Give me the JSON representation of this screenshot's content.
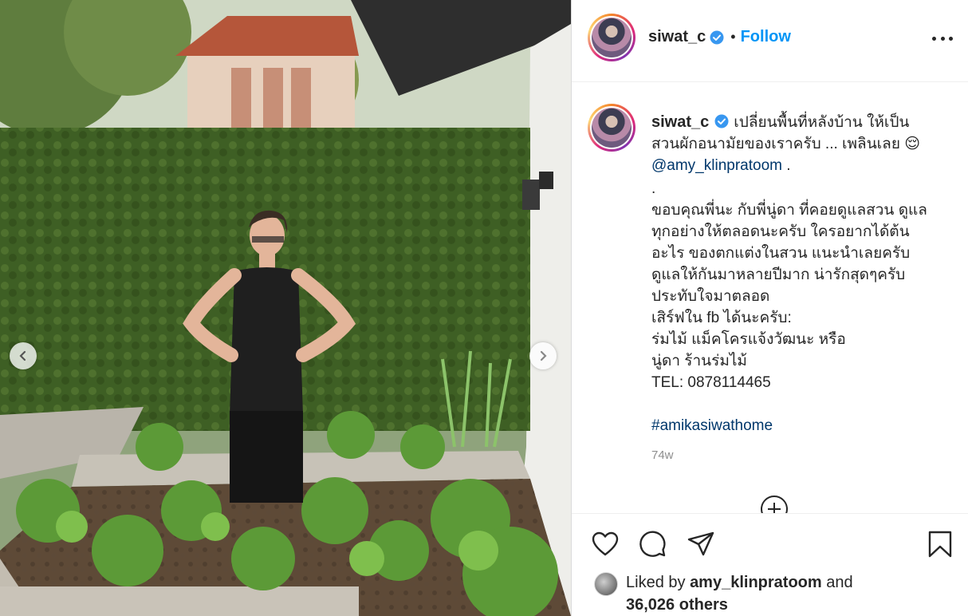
{
  "post": {
    "username": "siwat_c",
    "follow_label": "Follow",
    "separator": "•",
    "caption_lines": [
      "เปลี่ยนพื้นที่หลังบ้าน ให้เป็น",
      "สวนผักอนามัยของเราครับ ... เพลินเลย 😌"
    ],
    "caption_mention": "@amy_klinpratoom",
    "caption_mention_suffix": " .",
    "caption_dot": ".",
    "caption_body": [
      "ขอบคุณพี่นะ กับพี่นู่ดา ที่คอยดูแลสวน ดูแล",
      "ทุกอย่างให้ตลอดนะครับ ใครอยากได้ต้น",
      "อะไร ของตกแต่งในสวน แนะนำเลยครับ",
      "ดูแลให้กันมาหลายปีมาก น่ารักสุดๆครับ",
      "ประทับใจมาตลอด",
      "เสิร์ฟใน fb ได้นะครับ:",
      "ร่มไม้ แม็คโครแจ้งวัฒนะ หรือ",
      "นู่ดา ร้านร่มไม้",
      "TEL: 0878114465"
    ],
    "hashtag": "#amikasiwathome",
    "time_ago": "74w",
    "liked_prefix": "Liked by ",
    "liked_by_user": "amy_klinpratoom",
    "liked_and": " and",
    "liked_others": "36,026 others"
  },
  "icons": {
    "verified": "verified-badge-icon",
    "more": "more-options-icon",
    "like": "heart-icon",
    "comment": "comment-bubble-icon",
    "share": "paper-plane-icon",
    "save": "bookmark-icon",
    "prev": "chevron-left-icon",
    "next": "chevron-right-icon",
    "load_more": "plus-circle-icon"
  },
  "colors": {
    "accent": "#0095f6",
    "link": "#00376b",
    "muted": "#8e8e8e",
    "text": "#262626"
  }
}
